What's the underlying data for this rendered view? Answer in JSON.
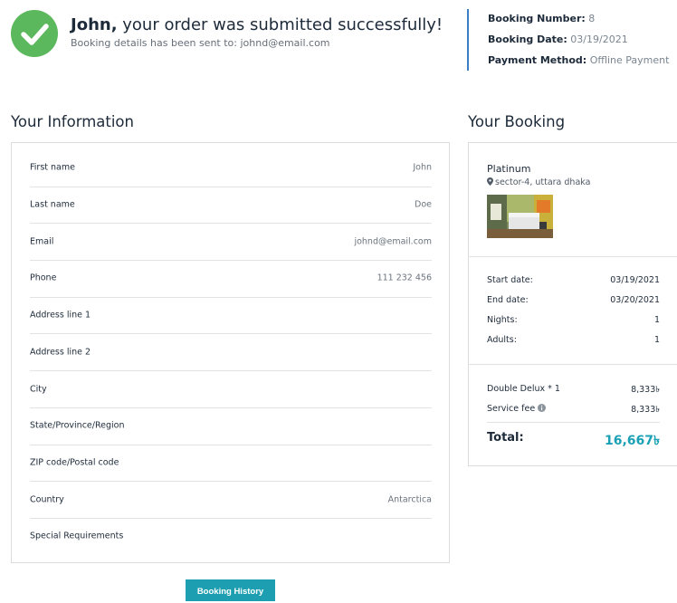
{
  "header": {
    "user_name": "John,",
    "success_text": " your order was submitted successfully!",
    "sub_text": "Booking details has been sent to: johnd@email.com"
  },
  "booking_meta": {
    "number_label": "Booking Number:",
    "number_value": "8",
    "date_label": "Booking Date:",
    "date_value": "03/19/2021",
    "payment_label": "Payment Method:",
    "payment_value": "Offline Payment"
  },
  "your_information": {
    "title": "Your Information",
    "rows": [
      {
        "label": "First name",
        "value": "John"
      },
      {
        "label": "Last name",
        "value": "Doe"
      },
      {
        "label": "Email",
        "value": "johnd@email.com"
      },
      {
        "label": "Phone",
        "value": "111 232 456"
      },
      {
        "label": "Address line 1",
        "value": ""
      },
      {
        "label": "Address line 2",
        "value": ""
      },
      {
        "label": "City",
        "value": ""
      },
      {
        "label": "State/Province/Region",
        "value": ""
      },
      {
        "label": "ZIP code/Postal code",
        "value": ""
      },
      {
        "label": "Country",
        "value": "Antarctica"
      },
      {
        "label": "Special Requirements",
        "value": ""
      }
    ]
  },
  "your_booking": {
    "title": "Your Booking",
    "hotel_name": "Platinum",
    "location": "sector-4, uttara dhaka",
    "dates": [
      {
        "label": "Start date:",
        "value": "03/19/2021"
      },
      {
        "label": "End date:",
        "value": "03/20/2021"
      },
      {
        "label": "Nights:",
        "value": "1"
      },
      {
        "label": "Adults:",
        "value": "1"
      }
    ],
    "charges": [
      {
        "label": "Double Delux * 1",
        "value": "8,333৳"
      },
      {
        "label": "Service fee",
        "value": "8,333৳"
      }
    ],
    "total_label": "Total:",
    "total_value": "16,667৳"
  },
  "actions": {
    "history_label": "Booking History"
  },
  "colors": {
    "success_green": "#5cb85c",
    "accent_teal": "#1e9fb1",
    "meta_bar_blue": "#3b7fc4"
  }
}
